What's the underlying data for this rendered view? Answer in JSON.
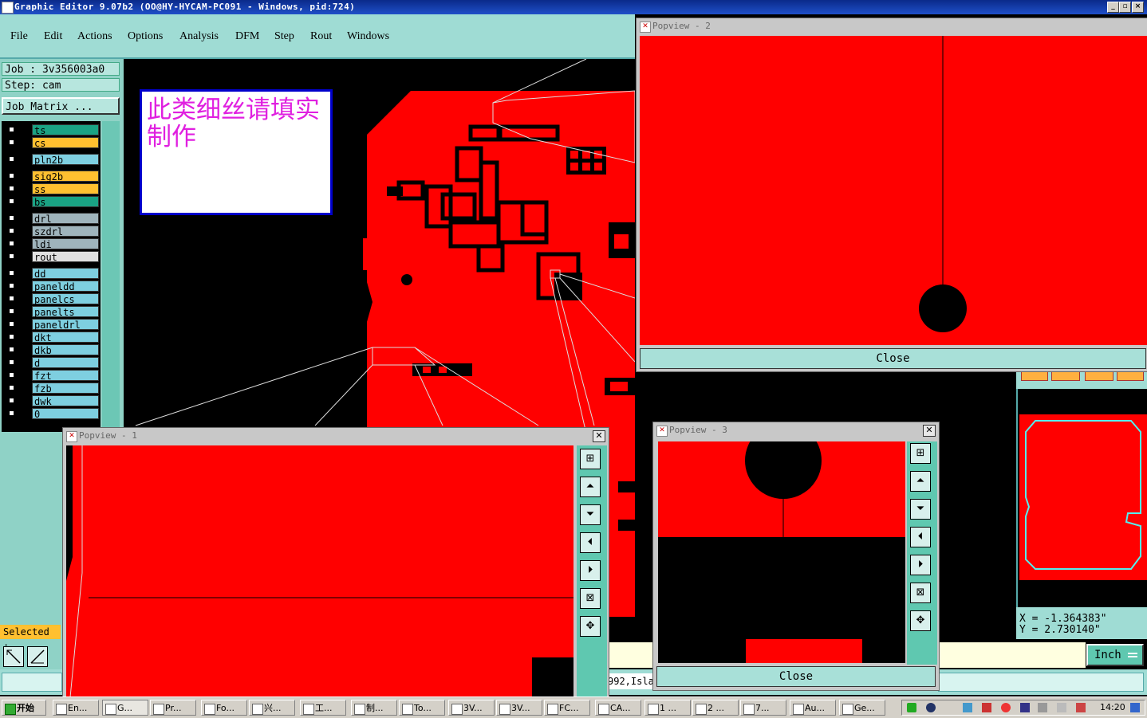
{
  "title": "Graphic Editor 9.07b2  (OO@HY-HYCAM-PC091 - Windows, pid:724)",
  "menu": [
    "File",
    "Edit",
    "Actions",
    "Options",
    "Analysis",
    "DFM",
    "Step",
    "Rout",
    "Windows"
  ],
  "job": {
    "job_label": "Job : 3v356003a0",
    "step_label": "Step: cam",
    "matrix_button": "Job Matrix ..."
  },
  "layers": [
    {
      "name": "ts",
      "color": "#1aa384"
    },
    {
      "name": "cs",
      "color": "#ffc030"
    },
    {
      "name": "pln2b",
      "color": "#7ecfe0"
    },
    {
      "name": "sig2b",
      "color": "#ffc030"
    },
    {
      "name": "ss",
      "color": "#ffc030"
    },
    {
      "name": "bs",
      "color": "#1aa384"
    },
    {
      "name": "drl",
      "color": "#9fb4bc"
    },
    {
      "name": "szdrl",
      "color": "#9fb4bc"
    },
    {
      "name": "ldi",
      "color": "#9fb4bc"
    },
    {
      "name": "rout",
      "color": "#e0e0e0"
    },
    {
      "name": "dd",
      "color": "#7ecfe0"
    },
    {
      "name": "paneldd",
      "color": "#7ecfe0"
    },
    {
      "name": "panelcs",
      "color": "#7ecfe0"
    },
    {
      "name": "panelts",
      "color": "#7ecfe0"
    },
    {
      "name": "paneldrl",
      "color": "#7ecfe0"
    },
    {
      "name": "dkt",
      "color": "#7ecfe0"
    },
    {
      "name": "dkb",
      "color": "#7ecfe0"
    },
    {
      "name": "d",
      "color": "#7ecfe0"
    },
    {
      "name": "fzt",
      "color": "#7ecfe0"
    },
    {
      "name": "fzb",
      "color": "#7ecfe0"
    },
    {
      "name": "dwk",
      "color": "#7ecfe0"
    },
    {
      "name": "0",
      "color": "#7ecfe0"
    }
  ],
  "selected_label": "Selected :",
  "note_text": "此类细丝请填实制作",
  "popview1": {
    "title": "Popview - 1"
  },
  "popview2": {
    "title": "Popview - 2",
    "close": "Close"
  },
  "popview3": {
    "title": "Popview - 3",
    "close": "Close"
  },
  "coords": {
    "x": "X = -1.364383\"",
    "y": "Y =  2.730140\""
  },
  "units": "Inch",
  "status_fragment": "992,Isla",
  "clock": "14:20",
  "start_label": "开始",
  "tasks": [
    "En...",
    "G...",
    "Pr...",
    "Fo...",
    "兴...",
    "工...",
    "制...",
    "To...",
    "3V...",
    "3V...",
    "FC...",
    "CA...",
    "1 ...",
    "2 ...",
    "7...",
    "Au...",
    "Ge..."
  ],
  "colors": {
    "board": "#ff0000",
    "panel": "#8fd2c6",
    "menubar": "#9fdcd4",
    "note_border": "#0000cc",
    "note_text": "#e020e0"
  }
}
